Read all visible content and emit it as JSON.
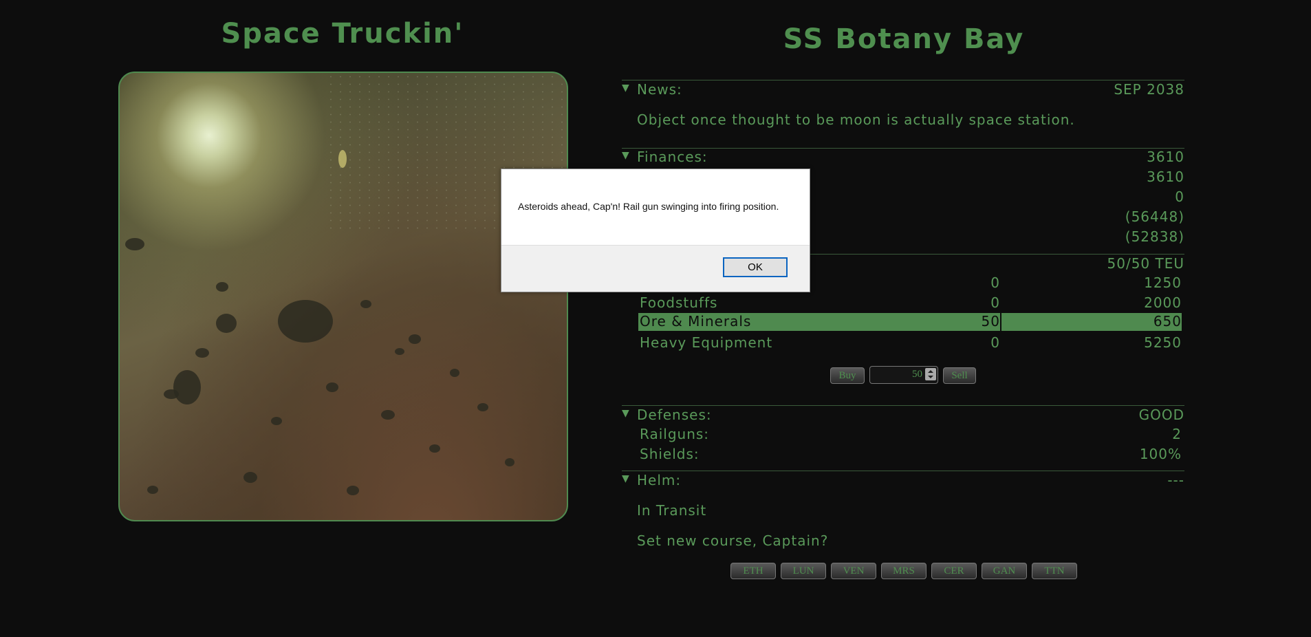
{
  "game_title": "Space Truckin'",
  "ship_name": "SS Botany Bay",
  "news": {
    "label": "News:",
    "date": "SEP 2038",
    "headline": "Object once thought to be moon is actually space station."
  },
  "finances": {
    "label": "Finances:",
    "total": "3610",
    "values": [
      "3610",
      "0",
      "(56448)",
      "(52838)"
    ]
  },
  "cargo": {
    "capacity": "50/50 TEU",
    "rows": [
      {
        "name": "",
        "held": "0",
        "price": "1250"
      },
      {
        "name": "Foodstuffs",
        "held": "0",
        "price": "2000"
      },
      {
        "name": "Ore & Minerals",
        "held": "50",
        "price": "650"
      },
      {
        "name": "Heavy Equipment",
        "held": "0",
        "price": "5250"
      }
    ],
    "buy_label": "Buy",
    "sell_label": "Sell",
    "quantity": "50"
  },
  "defenses": {
    "label": "Defenses:",
    "status": "GOOD",
    "railguns_label": "Railguns:",
    "railguns": "2",
    "shields_label": "Shields:",
    "shields": "100%"
  },
  "helm": {
    "label": "Helm:",
    "value": "---",
    "status": "In Transit",
    "prompt": "Set new course, Captain?",
    "destinations": [
      "ETH",
      "LUN",
      "VEN",
      "MRS",
      "CER",
      "GAN",
      "TTN"
    ]
  },
  "dialog": {
    "message": "Asteroids ahead, Cap'n!  Rail gun swinging into firing position.",
    "ok_label": "OK"
  },
  "colors": {
    "accent": "#4f8f4f",
    "background": "#0d0d0d",
    "highlight": "#4f8a4f"
  }
}
